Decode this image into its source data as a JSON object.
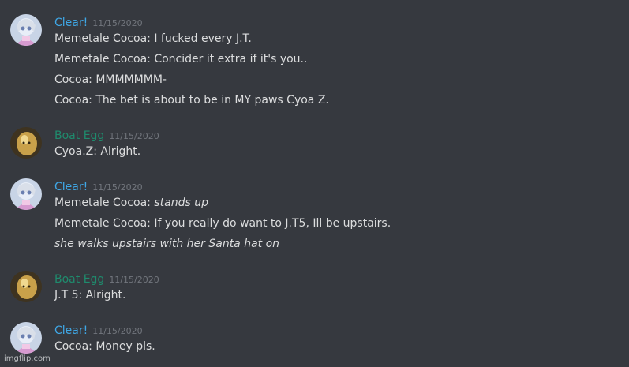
{
  "users": {
    "clear": {
      "name": "Clear!",
      "color": "#3fa7e6",
      "avatar_icon": "anime-girl-avatar"
    },
    "boat_egg": {
      "name": "Boat Egg",
      "color": "#1f8b6d",
      "avatar_icon": "egg-avatar"
    }
  },
  "messages": [
    {
      "author": "Clear!",
      "timestamp": "11/15/2020",
      "lines": [
        "Memetale Cocoa: I fucked every J.T.",
        "Memetale Cocoa: Concider it extra if it's you..",
        "Cocoa: MMMMMMM-",
        "Cocoa: The bet is about to be in MY paws Cyoa Z."
      ]
    },
    {
      "author": "Boat Egg",
      "timestamp": "11/15/2020",
      "lines": [
        "Cyoa.Z: Alright."
      ]
    },
    {
      "author": "Clear!",
      "timestamp": "11/15/2020",
      "line0_prefix": "Memetale Cocoa: ",
      "line0_italic": "stands up",
      "lines": [
        "Memetale Cocoa: If you really do want to J.T5, Ill be upstairs.",
        "she walks upstairs with her Santa hat on"
      ]
    },
    {
      "author": "Boat Egg",
      "timestamp": "11/15/2020",
      "lines": [
        "J.T 5: Alright."
      ]
    },
    {
      "author": "Clear!",
      "timestamp": "11/15/2020",
      "lines": [
        "Cocoa: Money pls."
      ]
    }
  ],
  "watermark": "imgflip.com"
}
